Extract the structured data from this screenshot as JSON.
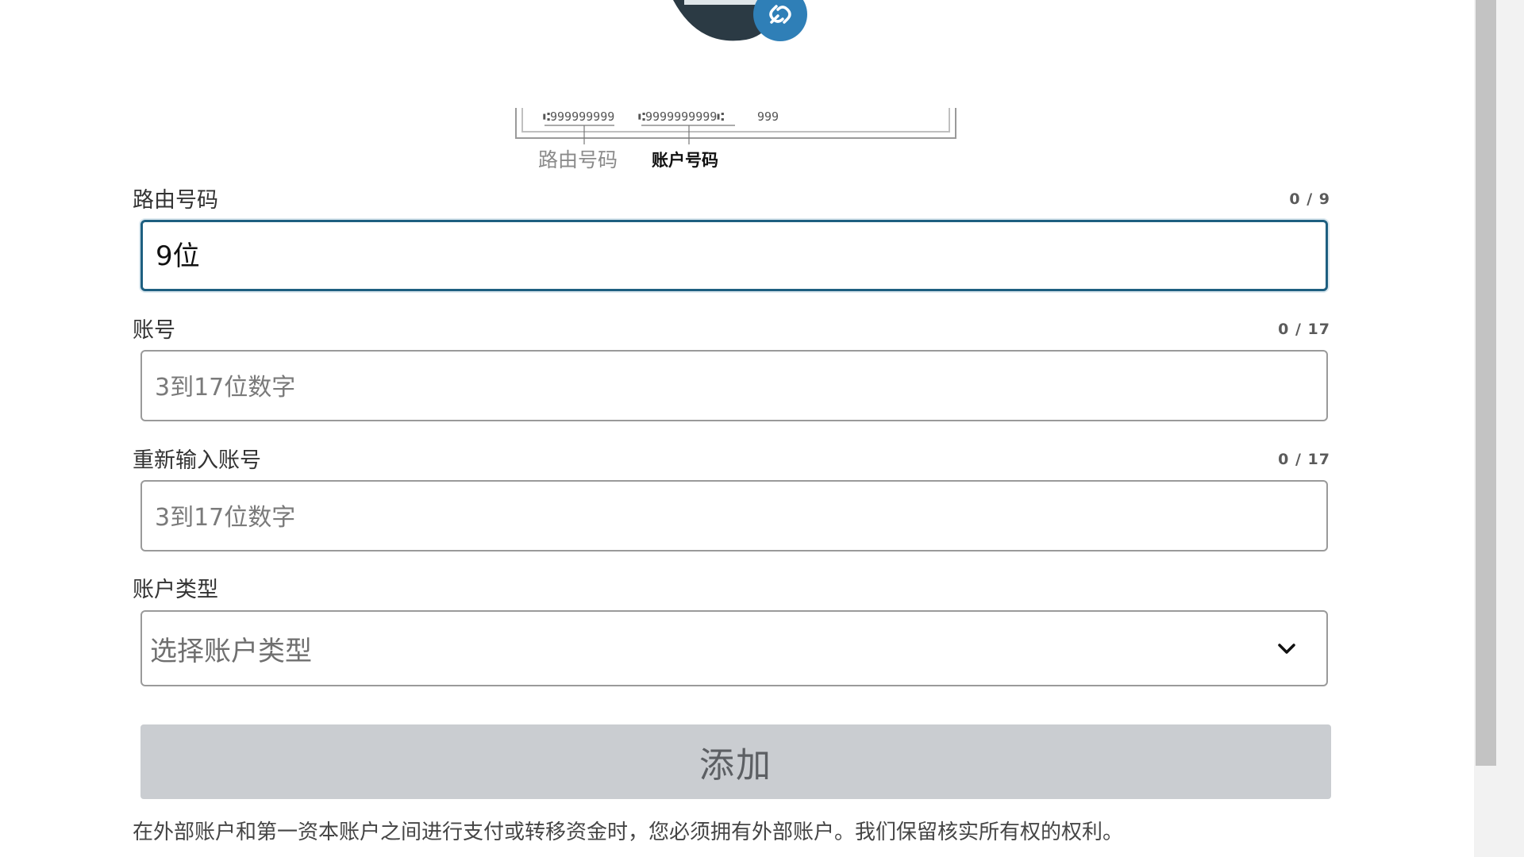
{
  "check_diagram": {
    "micr_routing_sample": "⑆999999999",
    "micr_account_sample": "⑆9999999999⑆",
    "micr_check_sample": "999",
    "routing_caption": "路由号码",
    "account_caption": "账户号码"
  },
  "form": {
    "routing": {
      "label": "路由号码",
      "counter": "0 / 9",
      "placeholder": "9位"
    },
    "account": {
      "label": "账号",
      "counter": "0 / 17",
      "placeholder": "3到17位数字"
    },
    "account_confirm": {
      "label": "重新输入账号",
      "counter": "0 / 17",
      "placeholder": "3到17位数字"
    },
    "account_type": {
      "label": "账户类型",
      "selected": "选择账户类型"
    },
    "submit_label": "添加",
    "disclaimer": "在外部账户和第一资本账户之间进行支付或转移资金时，您必须拥有外部账户。我们保留核实所有权的权利。"
  },
  "colors": {
    "focus_border": "#1e5f80",
    "button_disabled_bg": "#cacdd1",
    "illustration_dark": "#2b3a44",
    "link_badge": "#2f7fb7"
  },
  "icons": {
    "link_badge": "link-icon",
    "select_chevron": "chevron-down-icon"
  }
}
